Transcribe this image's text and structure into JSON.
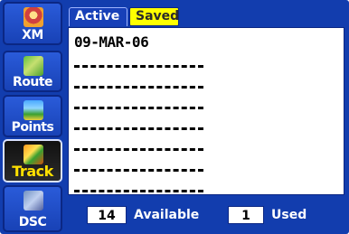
{
  "sidebar": {
    "items": [
      {
        "label": "XM",
        "icon": "xm-icon"
      },
      {
        "label": "Route",
        "icon": "route-icon"
      },
      {
        "label": "Points",
        "icon": "points-icon"
      },
      {
        "label": "Track",
        "icon": "track-icon",
        "selected": true
      },
      {
        "label": "DSC",
        "icon": "dsc-icon"
      }
    ]
  },
  "tabs": [
    {
      "label": "Active"
    },
    {
      "label": "Saved",
      "selected": true
    }
  ],
  "tracks": {
    "items": [
      "09-MAR-06",
      "",
      "",
      "",
      "",
      "",
      "",
      ""
    ]
  },
  "footer": {
    "available_count": "14",
    "available_label": "Available",
    "used_count": "1",
    "used_label": "Used"
  },
  "colors": {
    "background": "#123dae",
    "selected_tab": "#ffff00",
    "selected_nav_label": "#ffe000"
  }
}
